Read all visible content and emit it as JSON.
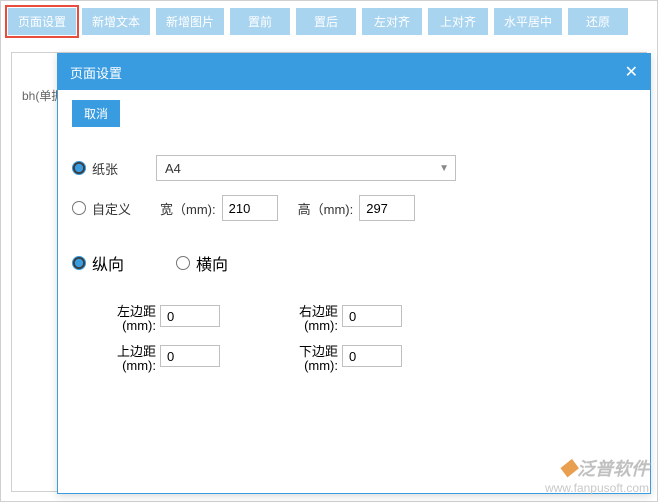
{
  "toolbar": {
    "buttons": [
      "页面设置",
      "新增文本",
      "新增图片",
      "置前",
      "置后",
      "左对齐",
      "上对齐",
      "水平居中",
      "还原"
    ]
  },
  "canvas": {
    "side_field": "bh(单据"
  },
  "modal": {
    "title": "页面设置",
    "cancel": "取消",
    "paper_radio": "纸张",
    "custom_radio": "自定义",
    "paper_select": "A4",
    "width_label": "宽（mm):",
    "width_value": "210",
    "height_label": "高（mm):",
    "height_value": "297",
    "portrait": "纵向",
    "landscape": "横向",
    "margins": {
      "left_label": "左边距(mm):",
      "left_value": "0",
      "top_label": "上边距(mm):",
      "top_value": "0",
      "right_label": "右边距(mm):",
      "right_value": "0",
      "bottom_label": "下边距(mm):",
      "bottom_value": "0"
    }
  },
  "watermark": {
    "brand_prefix": "泛普",
    "brand_suffix": "软件",
    "url": "www.fanpusoft.com"
  }
}
